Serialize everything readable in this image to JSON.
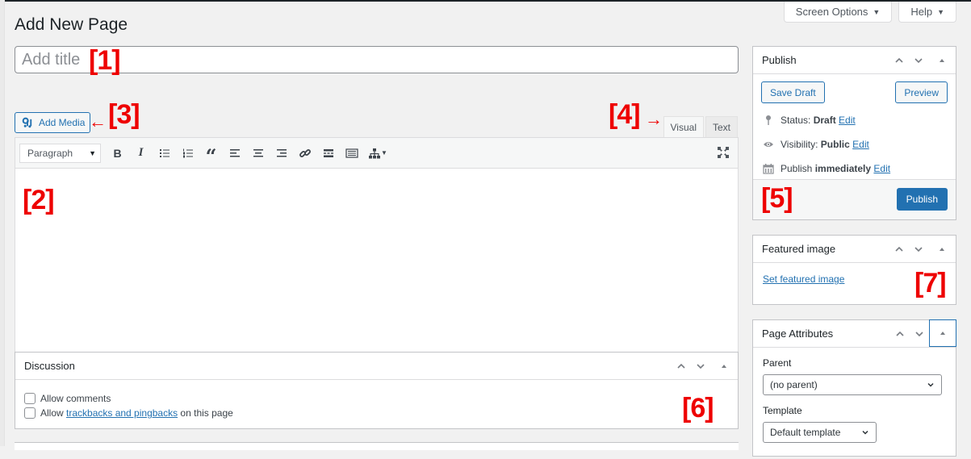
{
  "screen_meta": {
    "screen_options_label": "Screen Options",
    "help_label": "Help"
  },
  "page": {
    "title": "Add New Page"
  },
  "title_field": {
    "placeholder": "Add title",
    "value": ""
  },
  "annotations": {
    "a1": "[1]",
    "a2": "[2]",
    "a3": "[3]",
    "a4": "[4]",
    "a5": "[5]",
    "a6": "[6]",
    "a7": "[7]",
    "arrow_left": "←",
    "arrow_right": "→"
  },
  "editor": {
    "add_media_label": "Add Media",
    "tabs": [
      {
        "label": "Visual",
        "active": true
      },
      {
        "label": "Text",
        "active": false
      }
    ],
    "format_select": "Paragraph",
    "toolbar_buttons": [
      {
        "name": "bold",
        "icon": "bold-icon"
      },
      {
        "name": "italic",
        "icon": "italic-icon"
      },
      {
        "name": "bulleted-list",
        "icon": "bulleted-list-icon"
      },
      {
        "name": "numbered-list",
        "icon": "numbered-list-icon"
      },
      {
        "name": "blockquote",
        "icon": "quote-icon"
      },
      {
        "name": "align-left",
        "icon": "align-left-icon"
      },
      {
        "name": "align-center",
        "icon": "align-center-icon"
      },
      {
        "name": "align-right",
        "icon": "align-right-icon"
      },
      {
        "name": "insert-link",
        "icon": "link-icon"
      },
      {
        "name": "read-more",
        "icon": "read-more-icon"
      },
      {
        "name": "toolbar-toggle",
        "icon": "keyboard-icon"
      },
      {
        "name": "sitemap",
        "icon": "sitemap-icon"
      }
    ],
    "bold_glyph": "B",
    "italic_glyph": "I",
    "quote_glyph": "“"
  },
  "discussion": {
    "title": "Discussion",
    "allow_comments_label": "Allow comments",
    "allow_comments_checked": false,
    "allow_pings_prefix": "Allow ",
    "allow_pings_link": "trackbacks and pingbacks",
    "allow_pings_suffix": " on this page",
    "allow_pings_checked": false
  },
  "publish_box": {
    "title": "Publish",
    "save_draft_label": "Save Draft",
    "preview_label": "Preview",
    "status_label": "Status: ",
    "status_value": "Draft",
    "visibility_label": "Visibility: ",
    "visibility_value": "Public",
    "publish_label": "Publish ",
    "publish_value": "immediately",
    "edit_label": "Edit",
    "publish_button_label": "Publish",
    "accent_color": "#2271b1"
  },
  "featured_image": {
    "title": "Featured image",
    "set_link": "Set featured image"
  },
  "page_attributes": {
    "title": "Page Attributes",
    "parent_label": "Parent",
    "parent_value": "(no parent)",
    "template_label": "Template",
    "template_value": "Default template"
  }
}
